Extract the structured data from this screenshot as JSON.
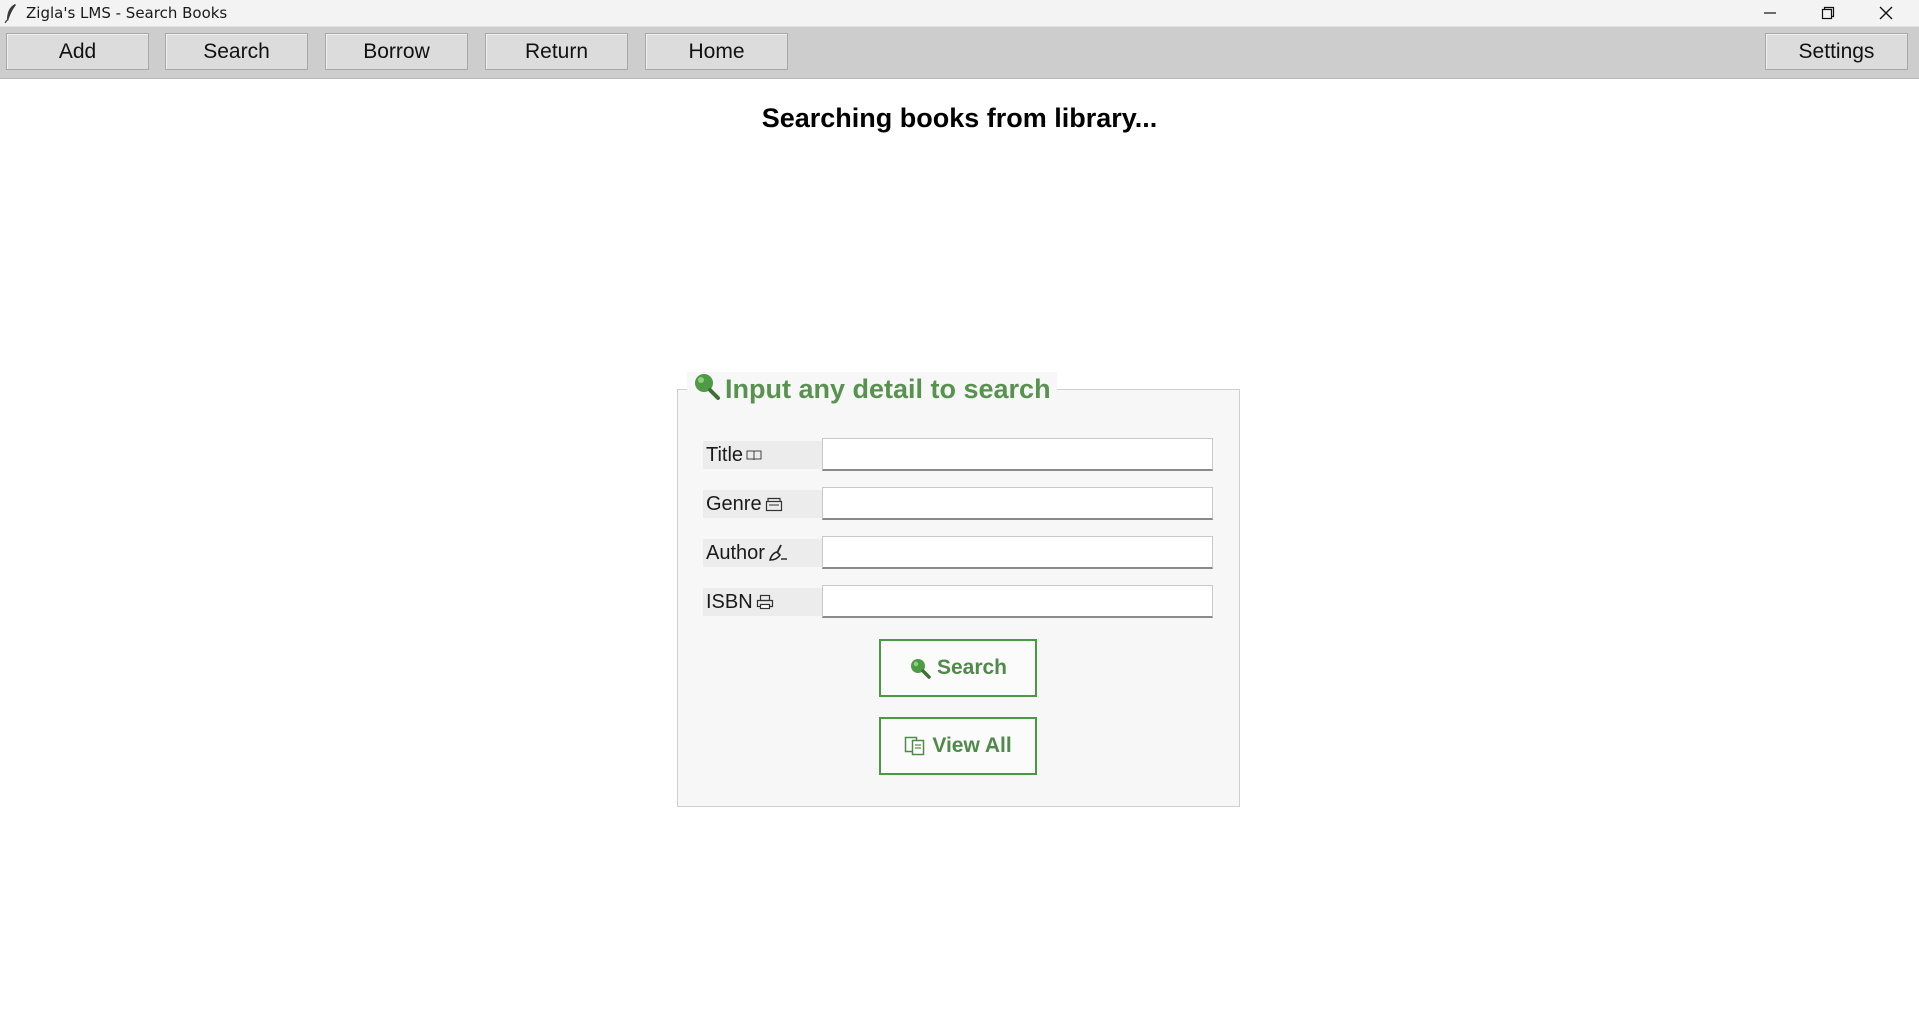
{
  "window": {
    "title": "Zigla's LMS - Search Books",
    "icon": "feather-icon",
    "controls": [
      "minimize-icon",
      "maximize-icon",
      "close-icon"
    ]
  },
  "toolbar": {
    "add_label": "Add",
    "search_label": "Search",
    "borrow_label": "Borrow",
    "return_label": "Return",
    "home_label": "Home",
    "settings_label": "Settings"
  },
  "main": {
    "heading": "Searching books from library..."
  },
  "search_form": {
    "legend": "Input any detail to search",
    "legend_icon": "magnifier-icon",
    "fields": [
      {
        "label": "Title",
        "icon": "open-book-icon",
        "value": "",
        "placeholder": ""
      },
      {
        "label": "Genre",
        "icon": "card-index-icon",
        "value": "",
        "placeholder": ""
      },
      {
        "label": "Author",
        "icon": "writing-hand-icon",
        "value": "",
        "placeholder": ""
      },
      {
        "label": "ISBN",
        "icon": "printer-icon",
        "value": "",
        "placeholder": ""
      }
    ],
    "search_button": "Search",
    "view_all_button": "View All"
  },
  "colors": {
    "accent_green": "#57924f",
    "button_border_green": "#4a9a45",
    "toolbar_bg": "#cdcdcd",
    "panel_bg": "#f7f7f7"
  }
}
